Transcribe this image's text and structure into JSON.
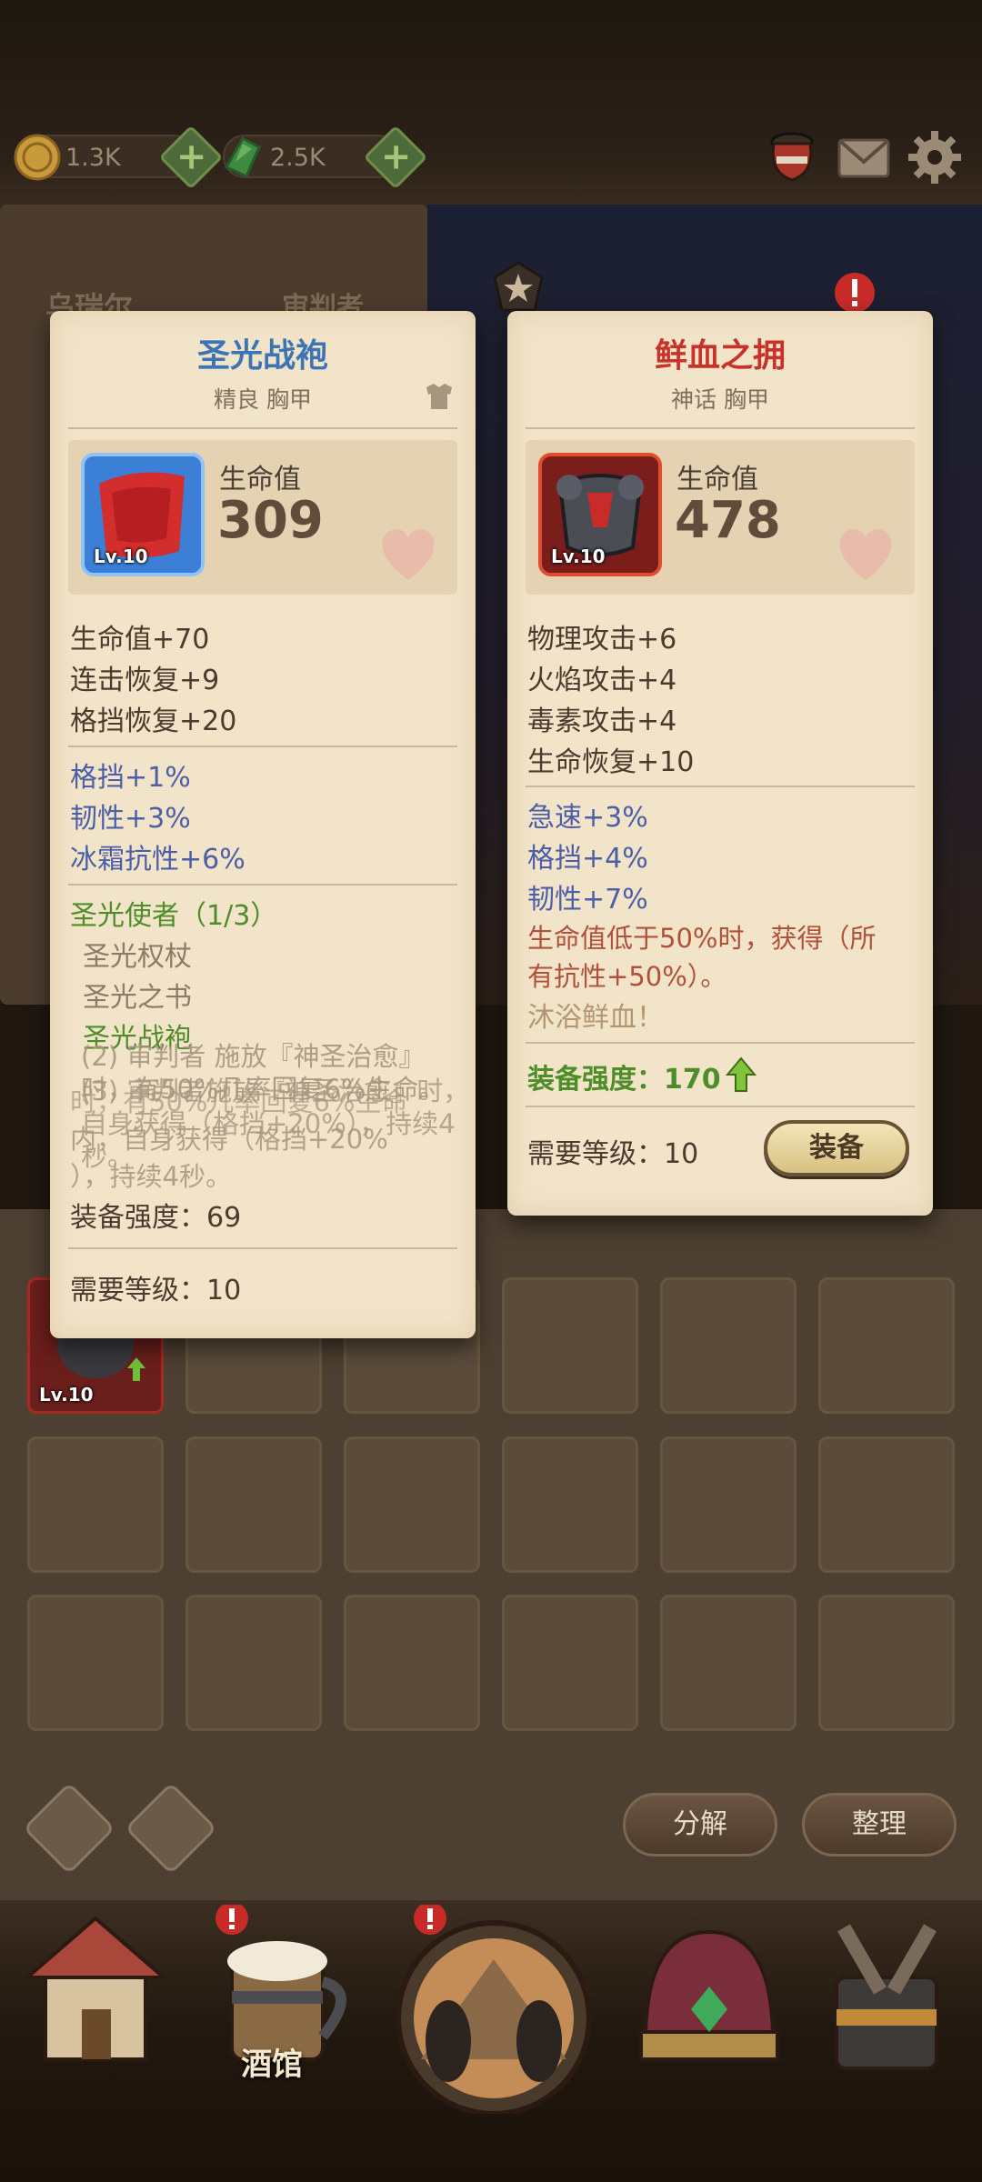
{
  "topbar": {
    "gold": "1.3K",
    "gems": "2.5K",
    "plus": "+"
  },
  "card_left": {
    "title": "圣光战袍",
    "subtitle": "精良 胸甲",
    "item_level": "Lv.10",
    "main_stat_label": "生命值",
    "main_stat_value": "309",
    "base_stats": [
      "生命值+70",
      "连击恢复+9",
      "格挡恢复+20"
    ],
    "extra_stats": [
      "格挡+1%",
      "韧性+3%",
      "冰霜抗性+6%"
    ],
    "set_name": "圣光使者（1/3）",
    "set_items": [
      "圣光权杖",
      "圣光之书",
      "圣光战袍"
    ],
    "set_bonus_2": "(2) 审判者 施放『神圣治愈』时，有50%几率回复6%生命。",
    "set_bonus_3": "(3) 审判者施放『神圣治愈』时，自身获得（格挡+20%），持续4秒。",
    "overlap_line1": "时，有50%几率回复6%生命",
    "overlap_line2": "内，自身获得（格挡+20%",
    "overlap_line3": "），持续4秒。",
    "power_label": "装备强度：69",
    "req_level": "需要等级：10"
  },
  "card_right": {
    "title": "鲜血之拥",
    "subtitle": "神话 胸甲",
    "item_level": "Lv.10",
    "main_stat_label": "生命值",
    "main_stat_value": "478",
    "base_stats": [
      "物理攻击+6",
      "火焰攻击+4",
      "毒素攻击+4",
      "生命恢复+10"
    ],
    "extra_stats": [
      "急速+3%",
      "格挡+4%",
      "韧性+7%"
    ],
    "passive_line1": "生命值低于50%时，获得（所",
    "passive_line2": "有抗性+50%）。",
    "flavor": "沐浴鲜血！",
    "power_label": "装备强度：170",
    "req_level": "需要等级：10",
    "equip_button": "装备"
  },
  "background": {
    "hero_name": "乌瑞尔",
    "hero_class": "审判者",
    "bag_item_level": "Lv.10"
  },
  "inventory": {
    "decompose_button": "分解",
    "sort_button": "整理"
  },
  "nav": {
    "tavern_label": "酒馆"
  },
  "colors": {
    "parchment": "#f2e4c9",
    "blue_title": "#3d74b5",
    "red_title": "#c8322a",
    "set_green": "#4f8d2a",
    "extra_blue": "#4d5ea8"
  }
}
